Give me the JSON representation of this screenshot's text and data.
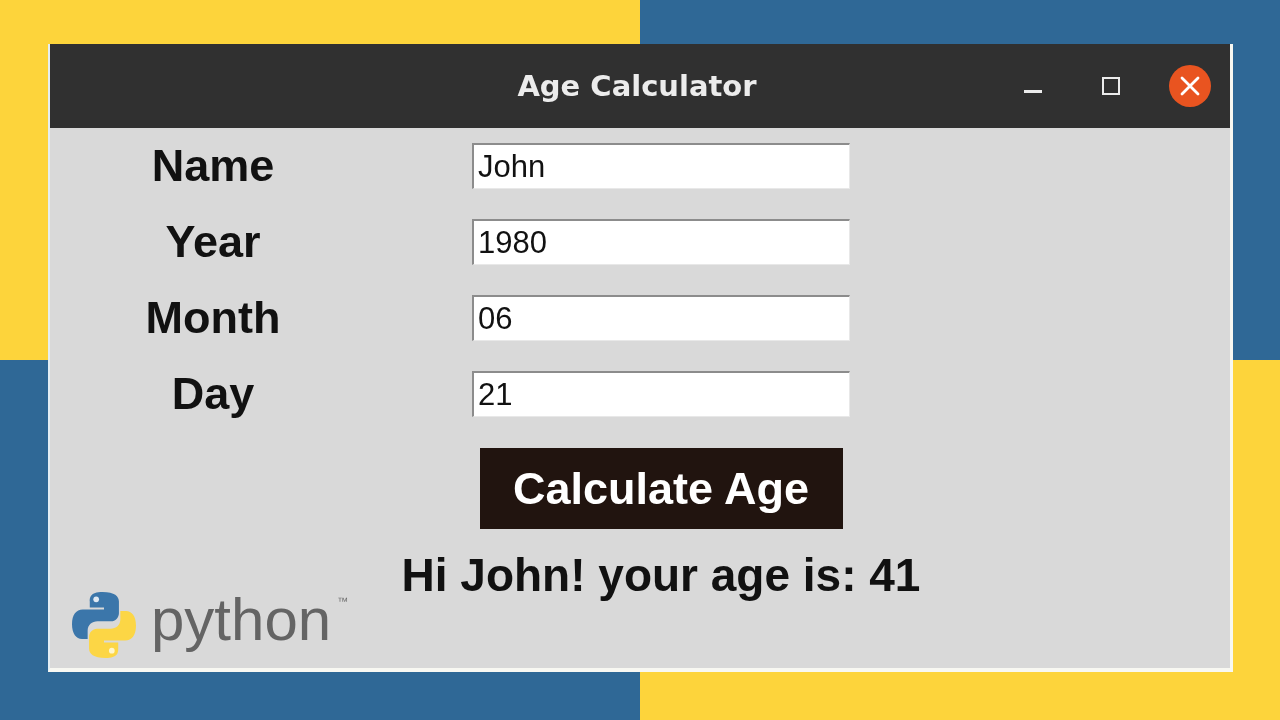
{
  "window": {
    "title": "Age Calculator"
  },
  "form": {
    "fields": [
      {
        "label": "Name",
        "value": "John"
      },
      {
        "label": "Year",
        "value": "1980"
      },
      {
        "label": "Month",
        "value": "06"
      },
      {
        "label": "Day",
        "value": "21"
      }
    ]
  },
  "button": {
    "label": "Calculate Age"
  },
  "result": "Hi John! your age is: 41",
  "logo": {
    "wordmark": "python",
    "trademark": "™"
  }
}
